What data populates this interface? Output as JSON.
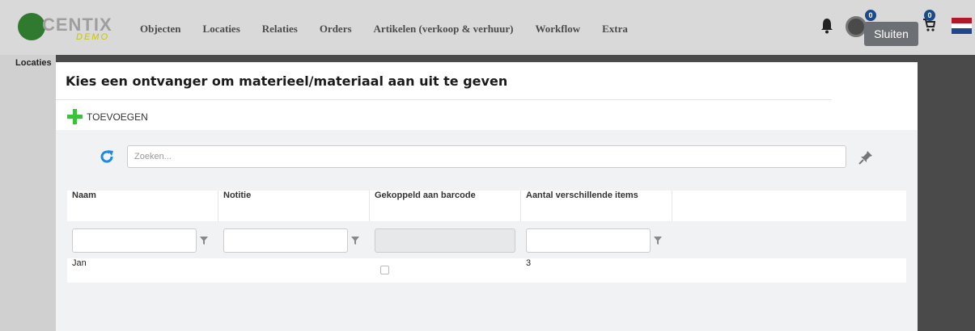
{
  "brand": {
    "name": "CENTIX",
    "sub": "DEMO"
  },
  "nav": {
    "items": [
      "Objecten",
      "Locaties",
      "Relaties",
      "Orders",
      "Artikelen (verkoop & verhuur)",
      "Workflow",
      "Extra"
    ]
  },
  "header": {
    "user_badge": "0",
    "cart_badge": "0",
    "close_label": "Sluiten"
  },
  "sidebar": {
    "label": "Locaties"
  },
  "modal": {
    "title": "Kies een ontvanger om materieel/materiaal aan uit te geven",
    "add_label": "TOEVOEGEN",
    "search_placeholder": "Zoeken...",
    "columns": [
      "Naam",
      "Notitie",
      "Gekoppeld aan barcode",
      "Aantal verschillende items"
    ],
    "rows": [
      {
        "naam": "Jan",
        "notitie": "",
        "barcode": false,
        "aantal": "3"
      }
    ]
  },
  "colors": {
    "accent_green": "#3cc13c",
    "refresh_blue": "#1e88e5",
    "badge_blue": "#1a4a8a"
  }
}
